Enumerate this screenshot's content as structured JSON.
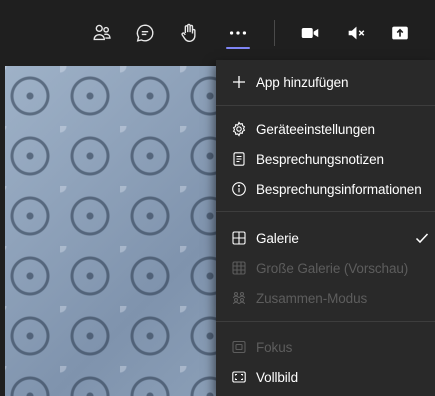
{
  "toolbar": {
    "buttons": [
      {
        "name": "participants-icon"
      },
      {
        "name": "chat-icon"
      },
      {
        "name": "raise-hand-icon"
      },
      {
        "name": "more-actions-icon",
        "active": true
      },
      {
        "name": "camera-icon"
      },
      {
        "name": "speaker-muted-icon"
      },
      {
        "name": "share-icon"
      }
    ],
    "accent_color": "#7f85f5"
  },
  "menu": {
    "items": [
      {
        "label": "App hinzufügen",
        "icon": "plus-icon",
        "enabled": true
      },
      {
        "label": "Geräteeinstellungen",
        "icon": "gear-icon",
        "enabled": true
      },
      {
        "label": "Besprechungsnotizen",
        "icon": "notes-icon",
        "enabled": true
      },
      {
        "label": "Besprechungsinformationen",
        "icon": "info-icon",
        "enabled": true
      },
      {
        "label": "Galerie",
        "icon": "gallery-icon",
        "enabled": true,
        "checked": true
      },
      {
        "label": "Große Galerie (Vorschau)",
        "icon": "large-gallery-icon",
        "enabled": false
      },
      {
        "label": "Zusammen-Modus",
        "icon": "together-mode-icon",
        "enabled": false
      },
      {
        "label": "Fokus",
        "icon": "focus-icon",
        "enabled": false
      },
      {
        "label": "Vollbild",
        "icon": "fullscreen-icon",
        "enabled": true
      }
    ]
  }
}
